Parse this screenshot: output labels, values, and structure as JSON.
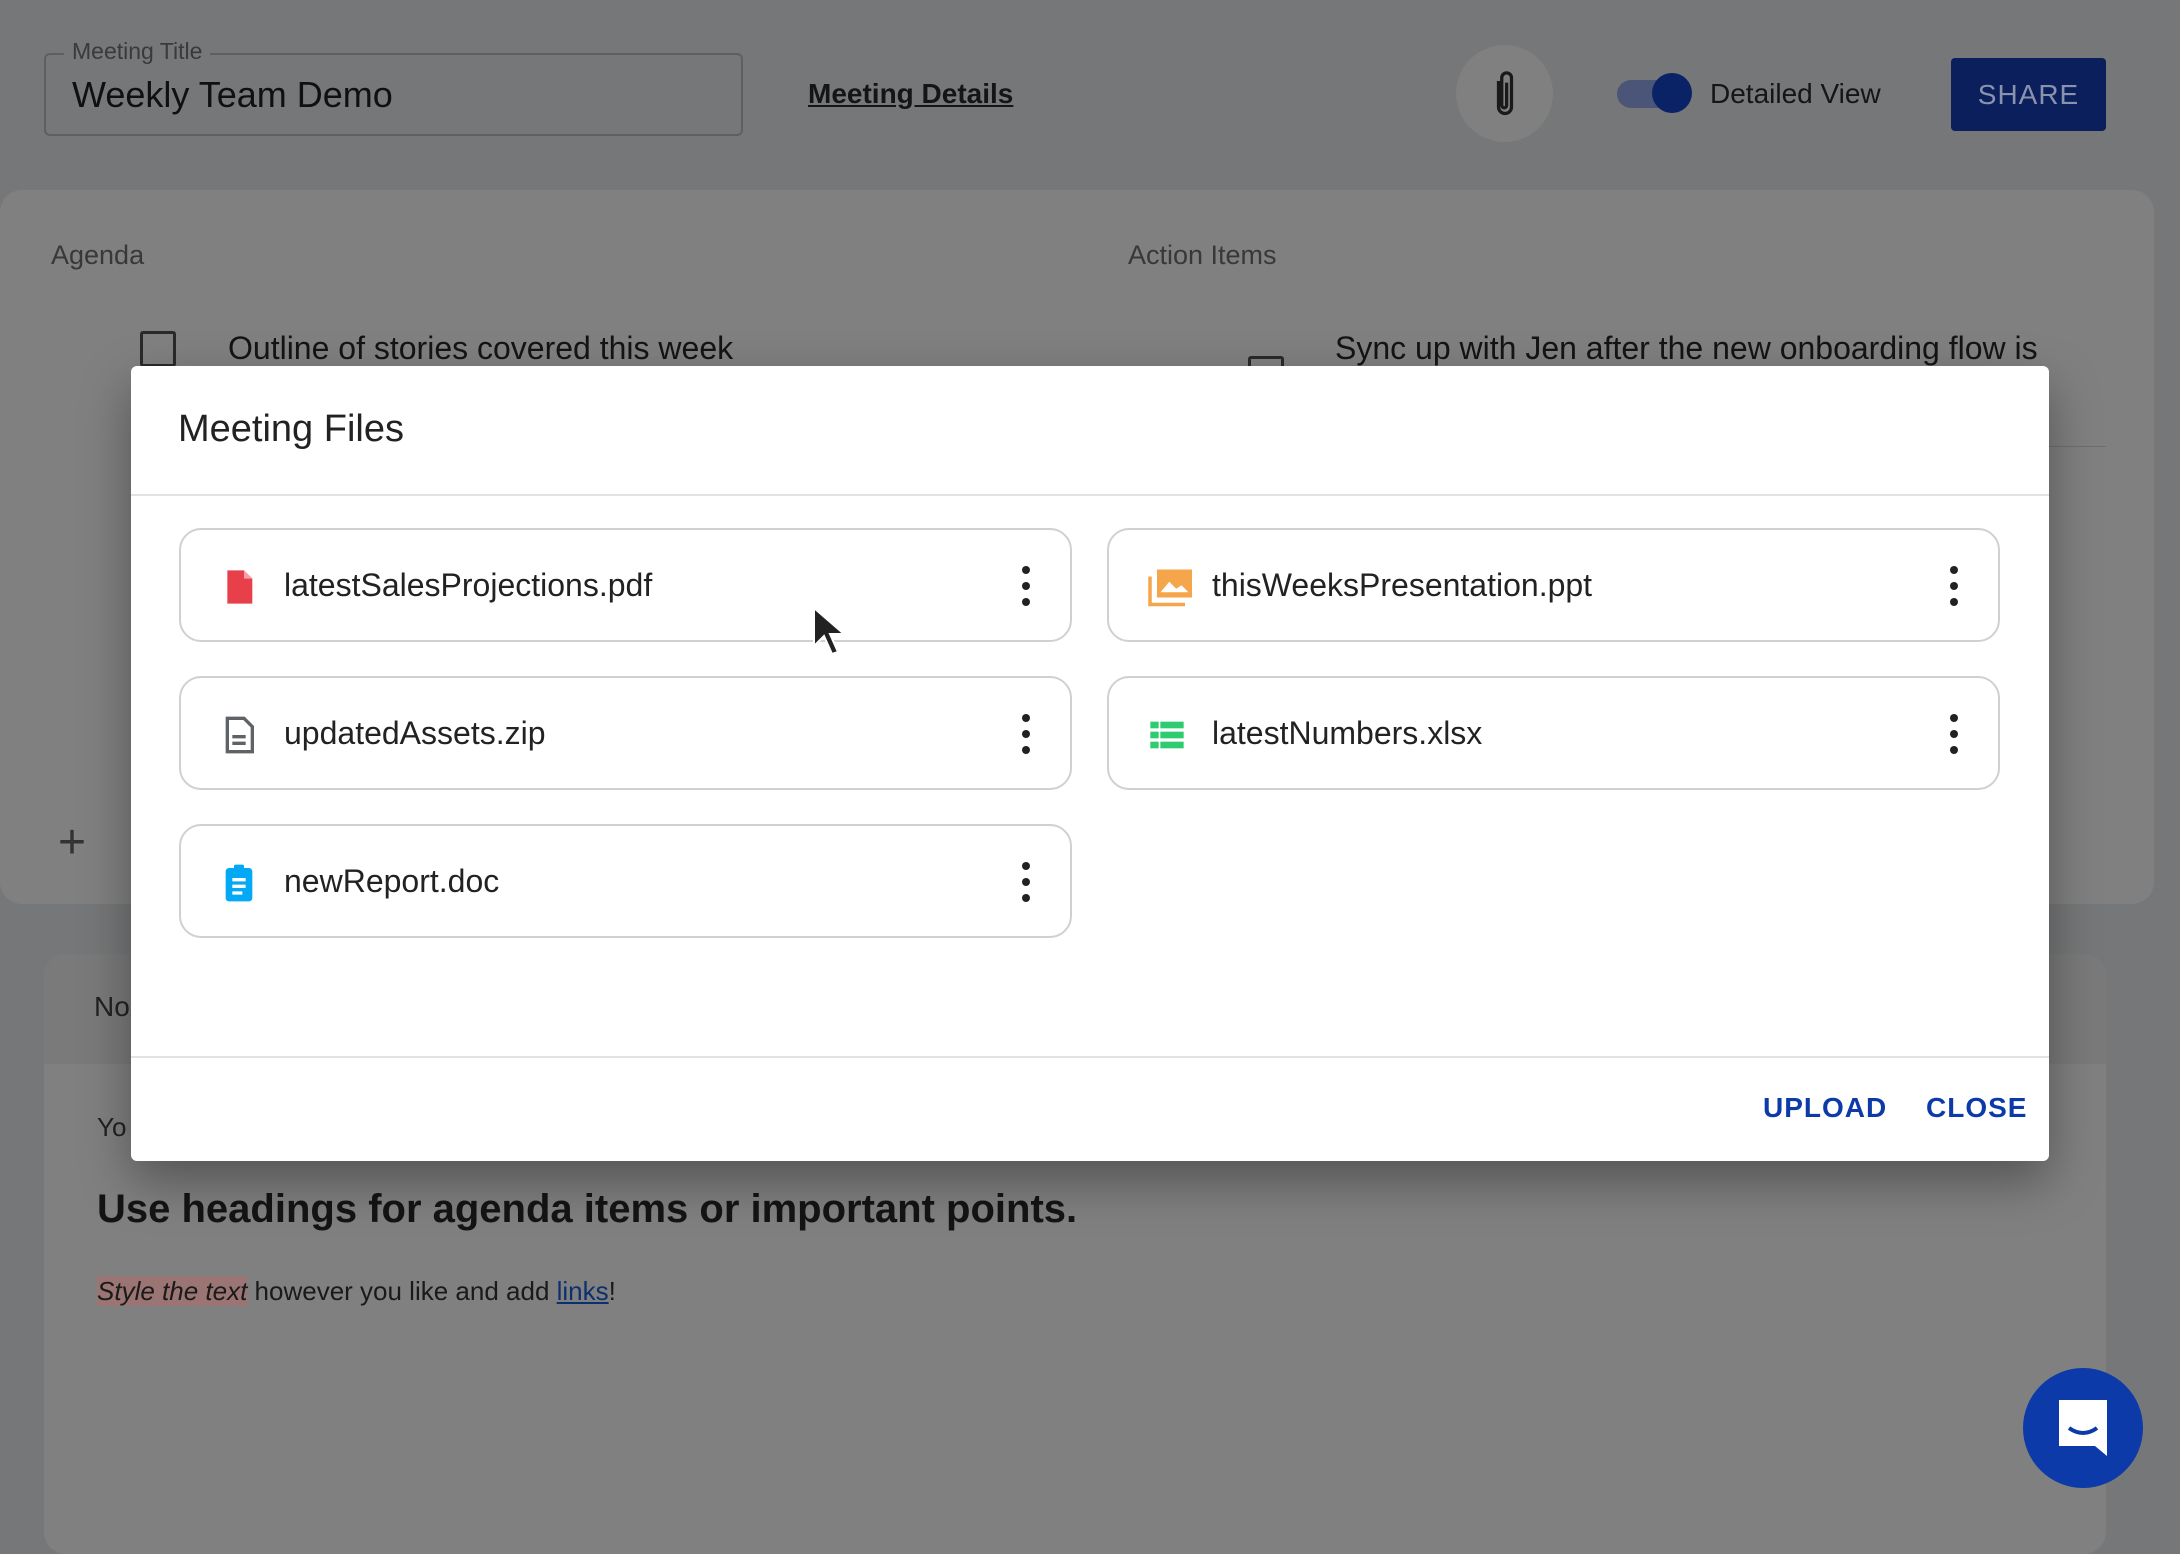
{
  "header": {
    "title_label": "Meeting Title",
    "title_value": "Weekly Team Demo",
    "details_link": "Meeting Details",
    "toggle_label": "Detailed View",
    "toggle_on": true,
    "share_label": "SHARE"
  },
  "agenda": {
    "label": "Agenda",
    "items": [
      {
        "text": "Outline of stories covered this week",
        "checked": false
      }
    ]
  },
  "action_items": {
    "label": "Action Items",
    "items": [
      {
        "text": "Sync up with Jen after the new onboarding flow is",
        "checked": false
      }
    ]
  },
  "notes": {
    "label_partial": "No",
    "line_partial": "Yo",
    "heading": "Use headings for agenda items or important points.",
    "styled": "Style the text",
    "middle": " however you like and add ",
    "link": "links",
    "end": "!"
  },
  "modal": {
    "title": "Meeting Files",
    "files": [
      {
        "name": "latestSalesProjections.pdf",
        "icon": "pdf-icon",
        "color": "#e8404a"
      },
      {
        "name": "thisWeeksPresentation.ppt",
        "icon": "image-folder-icon",
        "color": "#f5a54a"
      },
      {
        "name": "updatedAssets.zip",
        "icon": "document-icon",
        "color": "#5f6368"
      },
      {
        "name": "latestNumbers.xlsx",
        "icon": "table-icon",
        "color": "#2ecc71"
      },
      {
        "name": "newReport.doc",
        "icon": "clipboard-icon",
        "color": "#03a9f4"
      }
    ],
    "upload_label": "UPLOAD",
    "close_label": "CLOSE"
  },
  "colors": {
    "accent": "#0d3aa9",
    "share": "#0a1f5c"
  }
}
